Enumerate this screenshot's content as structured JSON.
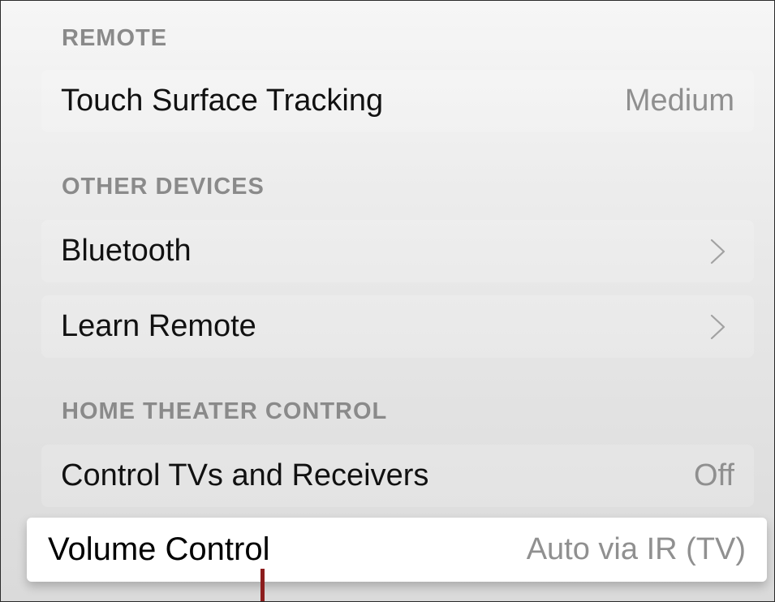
{
  "sections": {
    "remote": {
      "header": "REMOTE",
      "rows": [
        {
          "label": "Touch Surface Tracking",
          "value": "Medium"
        }
      ]
    },
    "other_devices": {
      "header": "OTHER DEVICES",
      "rows": [
        {
          "label": "Bluetooth",
          "icon": "chevron-right-icon"
        },
        {
          "label": "Learn Remote",
          "icon": "chevron-right-icon"
        }
      ]
    },
    "home_theater": {
      "header": "HOME THEATER CONTROL",
      "rows": [
        {
          "label": "Control TVs and Receivers",
          "value": "Off"
        },
        {
          "label": "Volume Control",
          "value": "Auto via IR (TV)",
          "focused": true
        }
      ]
    }
  },
  "colors": {
    "background_top": "#f6f6f6",
    "background_bottom": "#dadada",
    "header_text": "#8a8a8a",
    "label_text": "#111111",
    "value_text": "#8f8f8f",
    "focus_bg": "#ffffff",
    "pointer_accent": "#8c1d1d"
  }
}
